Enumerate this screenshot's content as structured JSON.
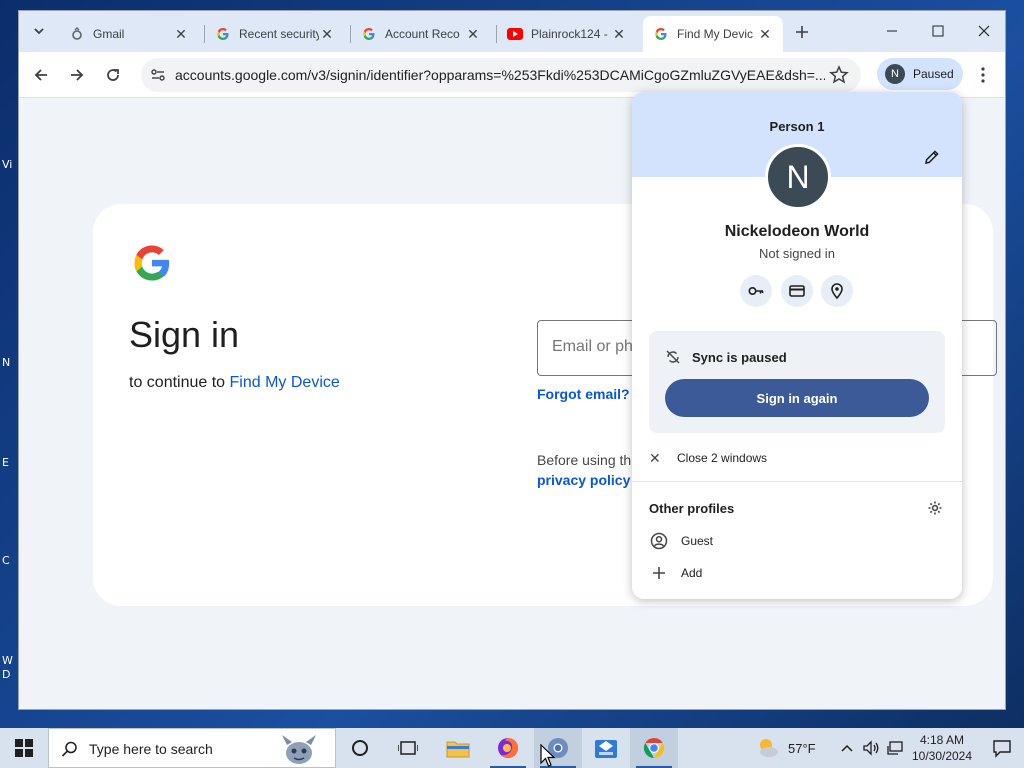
{
  "desktop": {
    "labels": [
      "Vi",
      "N",
      "E",
      "C",
      "W",
      "D"
    ]
  },
  "tabs": [
    {
      "title": "Gmail",
      "icon": "gmail-icon",
      "active": false
    },
    {
      "title": "Recent security",
      "icon": "google-icon",
      "active": false
    },
    {
      "title": "Account Reco",
      "icon": "google-icon",
      "active": false
    },
    {
      "title": "Plainrock124 -",
      "icon": "youtube-icon",
      "active": false
    },
    {
      "title": "Find My Devic",
      "icon": "google-icon",
      "active": true
    }
  ],
  "toolbar": {
    "url": "accounts.google.com/v3/signin/identifier?opparams=%253Fkdi%253DCAMiCgoGZmluZGVyEAE&dsh=...",
    "profile_chip": {
      "initial": "N",
      "label": "Paused"
    }
  },
  "signin": {
    "title": "Sign in",
    "subtitle_prefix": "to continue to ",
    "subtitle_link": "Find My Device",
    "email_placeholder": "Email or phone",
    "forgot_email": "Forgot email?",
    "before_text": "Before using this app, you can review Find My Device's",
    "privacy_link": "privacy policy"
  },
  "profile_menu": {
    "person_label": "Person 1",
    "avatar_initial": "N",
    "name": "Nickelodeon World",
    "status": "Not signed in",
    "quick_actions": [
      "password-key-icon",
      "payment-card-icon",
      "location-pin-icon"
    ],
    "sync_text": "Sync is paused",
    "sign_in_again": "Sign in again",
    "close_windows": "Close 2 windows",
    "other_profiles_title": "Other profiles",
    "guest": "Guest",
    "add": "Add"
  },
  "taskbar": {
    "search_placeholder": "Type here to search",
    "temperature": "57°F",
    "time": "4:18 AM",
    "date": "10/30/2024"
  },
  "colors": {
    "accent": "#0b57d0",
    "button": "#3d5a98",
    "header_tint": "#d3e3fd"
  }
}
